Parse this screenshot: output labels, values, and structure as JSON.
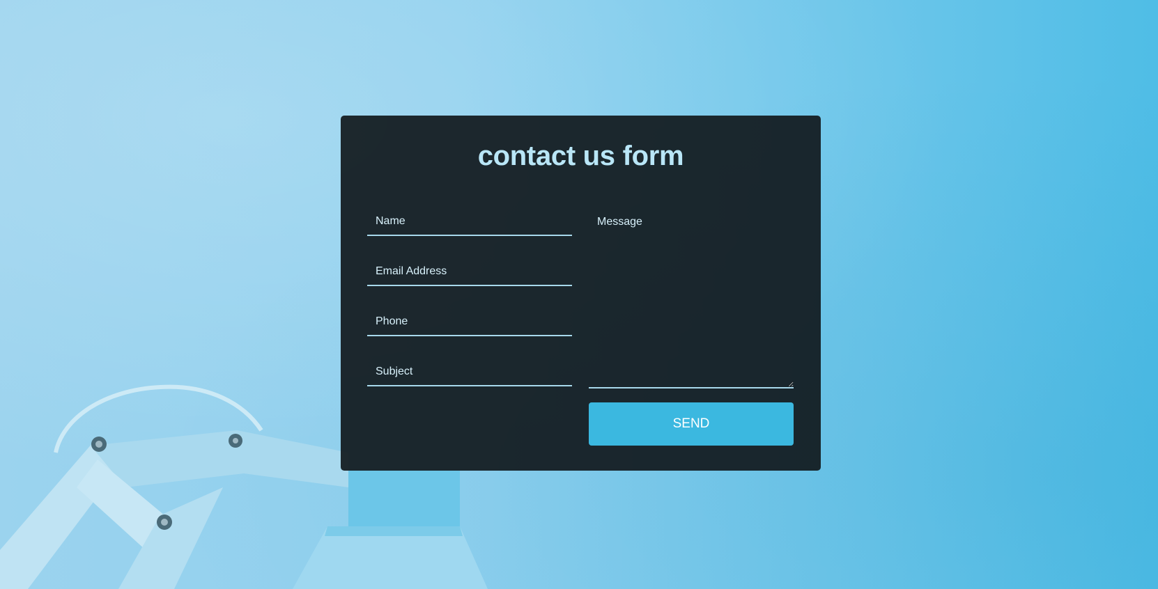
{
  "form": {
    "title": "contact us form",
    "name_placeholder": "Name",
    "email_placeholder": "Email Address",
    "phone_placeholder": "Phone",
    "subject_placeholder": "Subject",
    "message_placeholder": "Message",
    "send_label": "SEND"
  },
  "colors": {
    "card_background": "#121a1e",
    "title": "#b9e6f7",
    "underline": "#a8d9ec",
    "send_button": "#3bb8e0",
    "page_background": "#8fd0ee"
  },
  "background": {
    "image": "desk-lamp-photo"
  }
}
